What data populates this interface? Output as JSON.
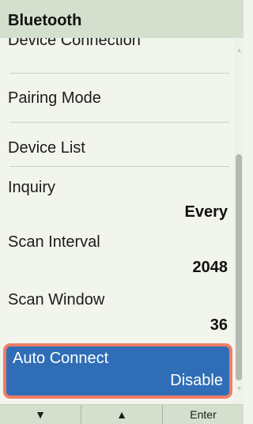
{
  "header": {
    "title": "Bluetooth"
  },
  "menu": {
    "items": [
      {
        "label": "Device Connection",
        "value": ""
      },
      {
        "label": "Pairing Mode",
        "value": ""
      },
      {
        "label": "Device List",
        "value": ""
      },
      {
        "label": "Inquiry",
        "value": "Every"
      },
      {
        "label": "Scan Interval",
        "value": "2048"
      },
      {
        "label": "Scan Window",
        "value": "36"
      },
      {
        "label": "Auto Connect",
        "value": "Disable"
      }
    ],
    "selected_index": 6
  },
  "scrollbar": {
    "up_icon": "▲",
    "down_icon": "▼"
  },
  "softkeys": {
    "down": "▼",
    "up": "▲",
    "enter": "Enter"
  },
  "colors": {
    "header_bg": "#d4dfcd",
    "selected_bg": "#2f6eb6",
    "selected_border": "#f07d66",
    "list_bg": "#f1f5ec"
  }
}
